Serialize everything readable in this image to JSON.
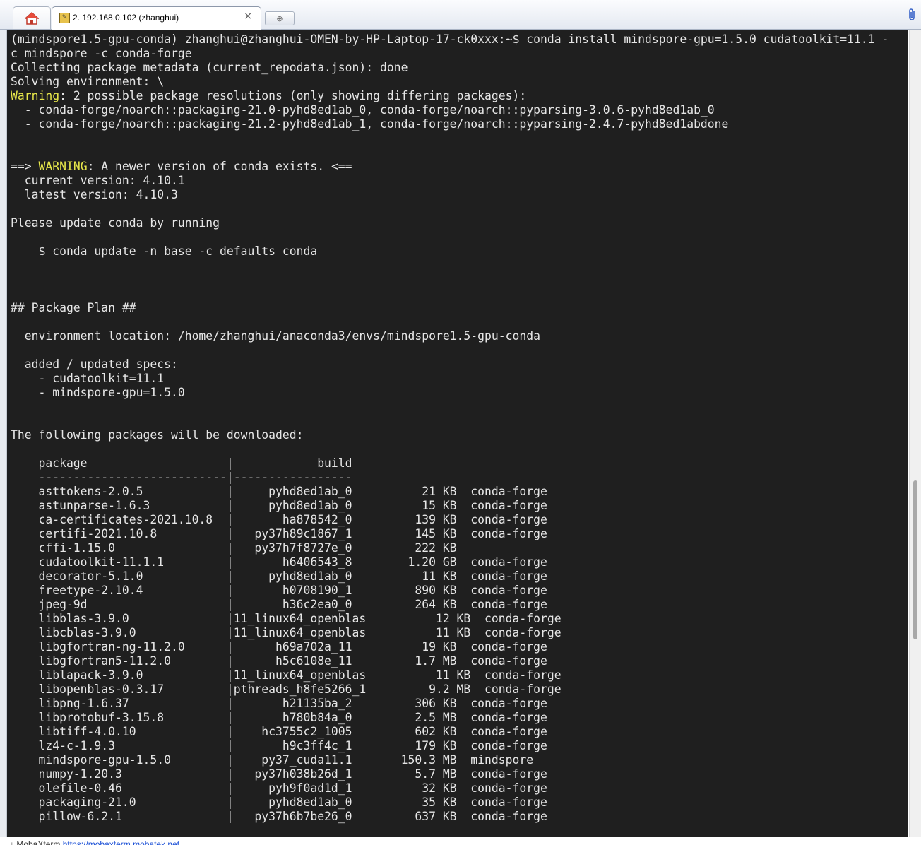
{
  "tabs": {
    "home_icon": "home-icon",
    "session_icon": "terminal-session-icon",
    "session_title": "2. 192.168.0.102 (zhanghui)",
    "close_glyph": "×",
    "new_tab_glyph": "⊕",
    "attach_icon": "paperclip-icon"
  },
  "terminal": {
    "lines": [
      "(mindspore1.5-gpu-conda) zhanghui@zhanghui-OMEN-by-HP-Laptop-17-ck0xxx:~$ conda install mindspore-gpu=1.5.0 cudatoolkit=11.1 -",
      "c mindspore -c conda-forge",
      "Collecting package metadata (current_repodata.json): done",
      "Solving environment: \\",
      {
        "hl": "Warning",
        "rest": ": 2 possible package resolutions (only showing differing packages):"
      },
      "  - conda-forge/noarch::packaging-21.0-pyhd8ed1ab_0, conda-forge/noarch::pyparsing-3.0.6-pyhd8ed1ab_0",
      "  - conda-forge/noarch::packaging-21.2-pyhd8ed1ab_1, conda-forge/noarch::pyparsing-2.4.7-pyhd8ed1abdone",
      "",
      "",
      {
        "pre": "==> ",
        "hl": "WARNING",
        "rest": ": A newer version of conda exists. <=="
      },
      "  current version: 4.10.1",
      "  latest version: 4.10.3",
      "",
      "Please update conda by running",
      "",
      "    $ conda update -n base -c defaults conda",
      "",
      "",
      "",
      "## Package Plan ##",
      "",
      "  environment location: /home/zhanghui/anaconda3/envs/mindspore1.5-gpu-conda",
      "",
      "  added / updated specs:",
      "    - cudatoolkit=11.1",
      "    - mindspore-gpu=1.5.0",
      "",
      "",
      "The following packages will be downloaded:",
      "",
      "    package                    |            build",
      "    ---------------------------|-----------------",
      "    asttokens-2.0.5            |     pyhd8ed1ab_0          21 KB  conda-forge",
      "    astunparse-1.6.3           |     pyhd8ed1ab_0          15 KB  conda-forge",
      "    ca-certificates-2021.10.8  |       ha878542_0         139 KB  conda-forge",
      "    certifi-2021.10.8          |   py37h89c1867_1         145 KB  conda-forge",
      "    cffi-1.15.0                |   py37h7f8727e_0         222 KB",
      "    cudatoolkit-11.1.1         |       h6406543_8        1.20 GB  conda-forge",
      "    decorator-5.1.0            |     pyhd8ed1ab_0          11 KB  conda-forge",
      "    freetype-2.10.4            |       h0708190_1         890 KB  conda-forge",
      "    jpeg-9d                    |       h36c2ea0_0         264 KB  conda-forge",
      "    libblas-3.9.0              |11_linux64_openblas          12 KB  conda-forge",
      "    libcblas-3.9.0             |11_linux64_openblas          11 KB  conda-forge",
      "    libgfortran-ng-11.2.0      |      h69a702a_11          19 KB  conda-forge",
      "    libgfortran5-11.2.0        |      h5c6108e_11         1.7 MB  conda-forge",
      "    liblapack-3.9.0            |11_linux64_openblas          11 KB  conda-forge",
      "    libopenblas-0.3.17         |pthreads_h8fe5266_1         9.2 MB  conda-forge",
      "    libpng-1.6.37              |       h21135ba_2         306 KB  conda-forge",
      "    libprotobuf-3.15.8         |       h780b84a_0         2.5 MB  conda-forge",
      "    libtiff-4.0.10             |    hc3755c2_1005         602 KB  conda-forge",
      "    lz4-c-1.9.3                |       h9c3ff4c_1         179 KB  conda-forge",
      "    mindspore-gpu-1.5.0        |    py37_cuda11.1       150.3 MB  mindspore",
      "    numpy-1.20.3               |   py37h038b26d_1         5.7 MB  conda-forge",
      "    olefile-0.46               |     pyh9f0ad1d_1          32 KB  conda-forge",
      "    packaging-21.0             |     pyhd8ed1ab_0          35 KB  conda-forge",
      "    pillow-6.2.1               |   py37h6b7be26_0         637 KB  conda-forge"
    ]
  },
  "footer": {
    "text": "↓ MobaXterm",
    "link": "https://mobaxterm.mobatek.net"
  }
}
